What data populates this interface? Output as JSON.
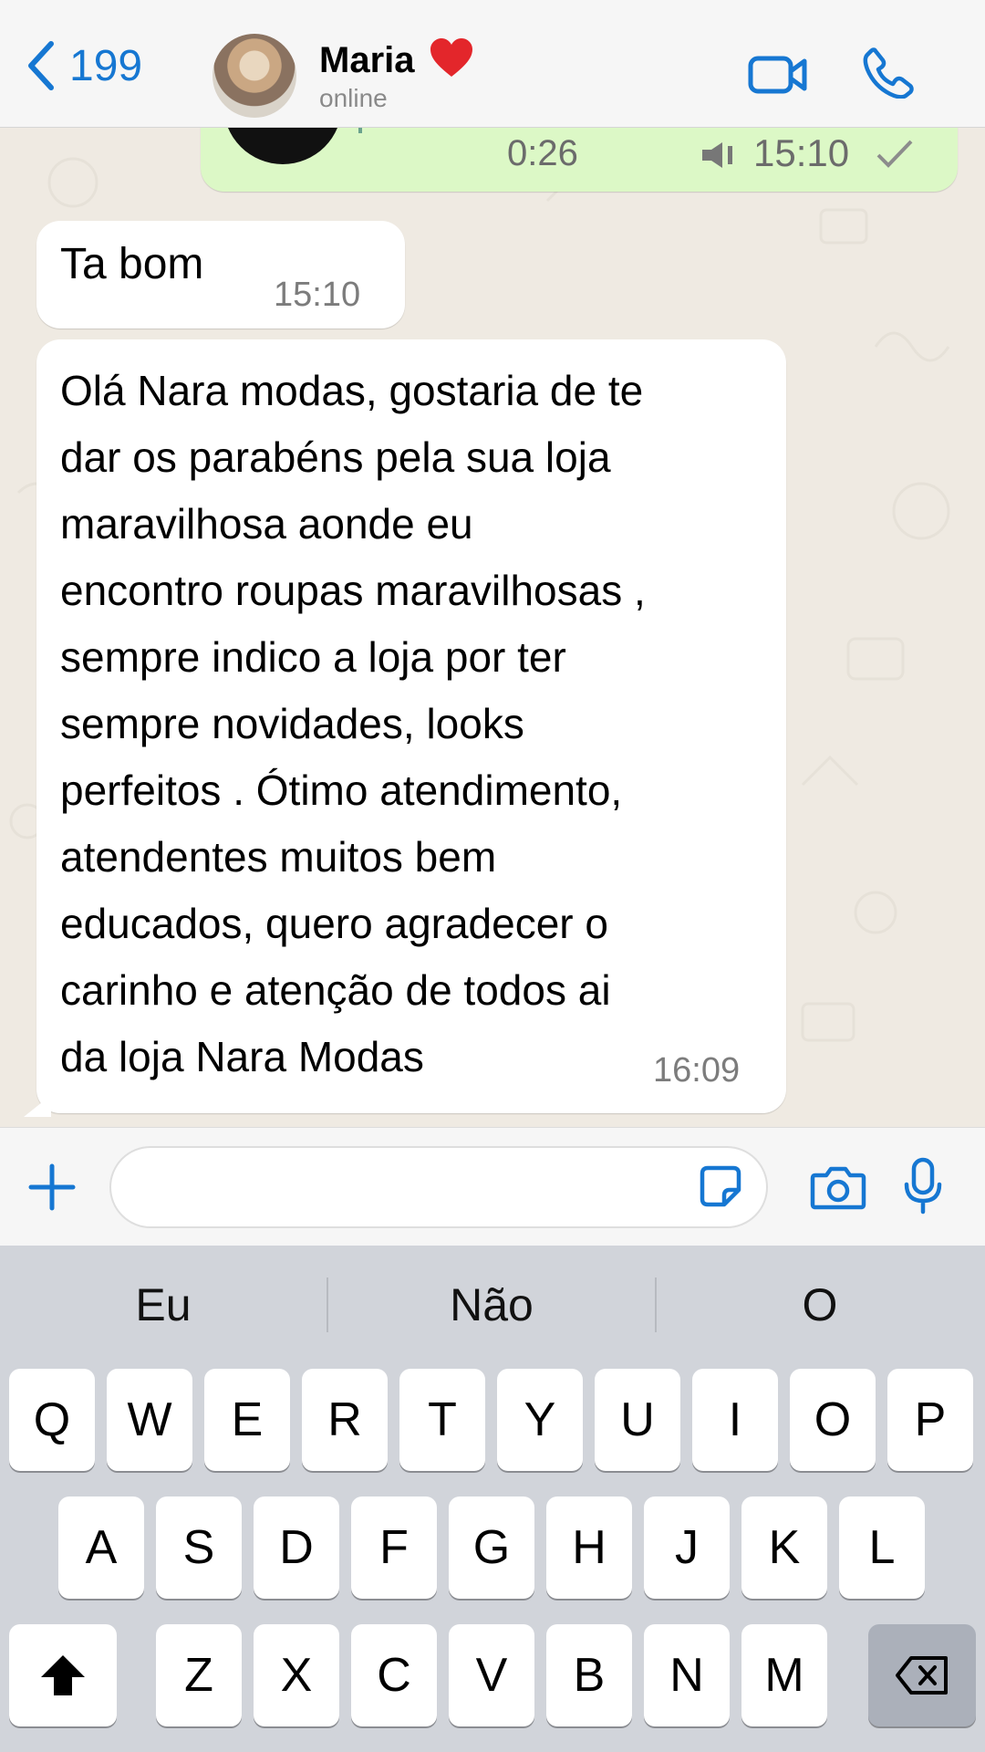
{
  "header": {
    "back_count": "199",
    "contact_name": "Maria",
    "contact_status": "online"
  },
  "chat": {
    "voice_message": {
      "duration": "0:26",
      "time": "15:10"
    },
    "messages": [
      {
        "text": "Ta bom",
        "time": "15:10"
      },
      {
        "text": "Olá Nara modas, gostaria de te\ndar os parabéns pela sua loja\nmaravilhosa aonde eu\nencontro roupas maravilhosas ,\nsempre indico a loja por ter\nsempre novidades, looks\nperfeitos . Ótimo atendimento,\natendentes muitos bem\neducados, quero agradecer o\ncarinho e atenção de todos ai\nda loja Nara Modas",
        "time": "16:09"
      }
    ]
  },
  "input": {
    "value": ""
  },
  "keyboard": {
    "suggestions": [
      "Eu",
      "Não",
      "O"
    ],
    "row1": [
      "Q",
      "W",
      "E",
      "R",
      "T",
      "Y",
      "U",
      "I",
      "O",
      "P"
    ],
    "row2": [
      "A",
      "S",
      "D",
      "F",
      "G",
      "H",
      "J",
      "K",
      "L"
    ],
    "row3": [
      "Z",
      "X",
      "C",
      "V",
      "B",
      "N",
      "M"
    ]
  },
  "colors": {
    "accent": "#1677d2",
    "outgoing_bubble": "#dcf8c6",
    "incoming_bubble": "#ffffff",
    "chat_background": "#efeae2",
    "heart": "#e3262b"
  },
  "icons": [
    "chevron-left-icon",
    "heart-icon",
    "video-call-icon",
    "phone-icon",
    "microphone-icon",
    "speaker-icon",
    "check-icon",
    "plus-icon",
    "sticker-icon",
    "camera-icon",
    "shift-icon",
    "backspace-icon"
  ]
}
